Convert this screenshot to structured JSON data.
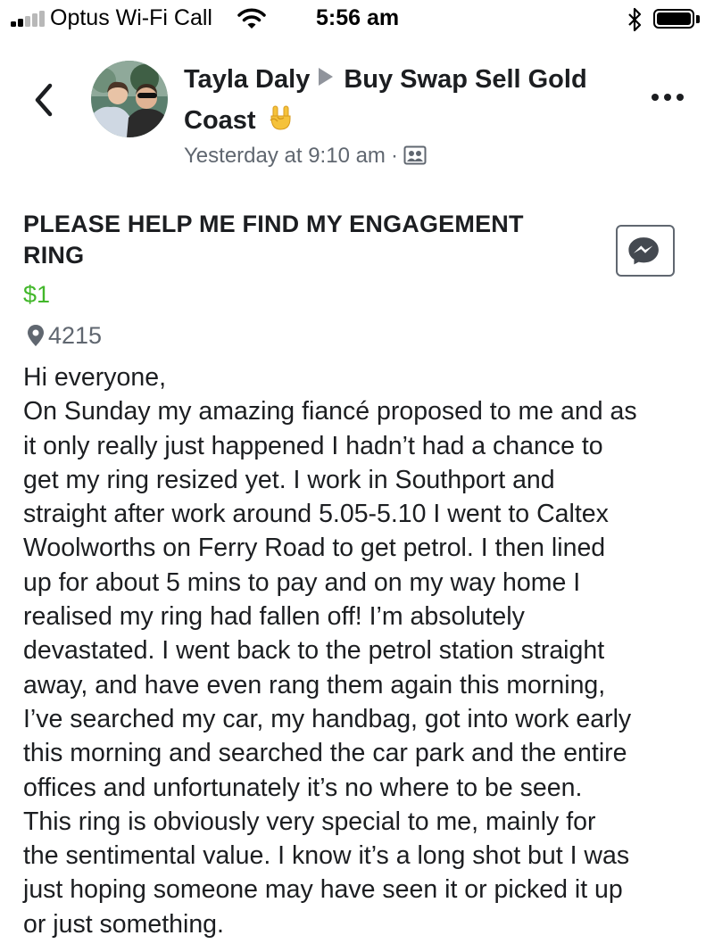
{
  "status_bar": {
    "carrier": "Optus Wi-Fi Call",
    "time": "5:56 am"
  },
  "post": {
    "author": "Tayla Daly",
    "group_line1": "Buy Swap Sell Gold",
    "group_line2": "Coast",
    "timestamp": "Yesterday at 9:10 am",
    "separator": "·"
  },
  "listing": {
    "title_line1": "PLEASE HELP ME FIND MY ENGAGEMENT",
    "title_line2": "RING",
    "price": "$1",
    "location": "4215",
    "description_lines": [
      "Hi everyone,",
      "On Sunday my amazing fiancé proposed to me and as",
      "it only really just happened I hadn’t had a chance to",
      "get my ring resized yet. I work in Southport and",
      "straight after work around 5.05-5.10 I went to Caltex",
      "Woolworths on Ferry Road to get petrol. I then lined",
      "up for about 5 mins to pay and on my way home I",
      "realised my ring had fallen off! I’m absolutely",
      "devastated. I went back to the petrol station straight",
      "away, and have even rang them again this morning,",
      "I’ve searched my car, my handbag, got into work early",
      "this morning and searched the car park and the entire",
      "offices and unfortunately it’s no where to be seen.",
      "This ring is obviously very special to me, mainly for",
      "the sentimental value. I know it’s a long shot but I was",
      "just hoping someone may have seen it or picked it up",
      "or just something."
    ]
  },
  "icons": {
    "signal": "cellular-signal-icon",
    "wifi": "wifi-icon",
    "bluetooth": "bluetooth-icon",
    "battery": "battery-icon",
    "back": "chevron-left-icon",
    "group_arrow": "triangle-right-icon",
    "emoji": "rock-hand-emoji-icon",
    "audience": "group-audience-icon",
    "more": "more-options-icon",
    "messenger": "messenger-icon",
    "location": "location-pin-icon"
  },
  "colors": {
    "text": "#1c1e21",
    "secondary": "#606770",
    "price": "#42b72a"
  }
}
